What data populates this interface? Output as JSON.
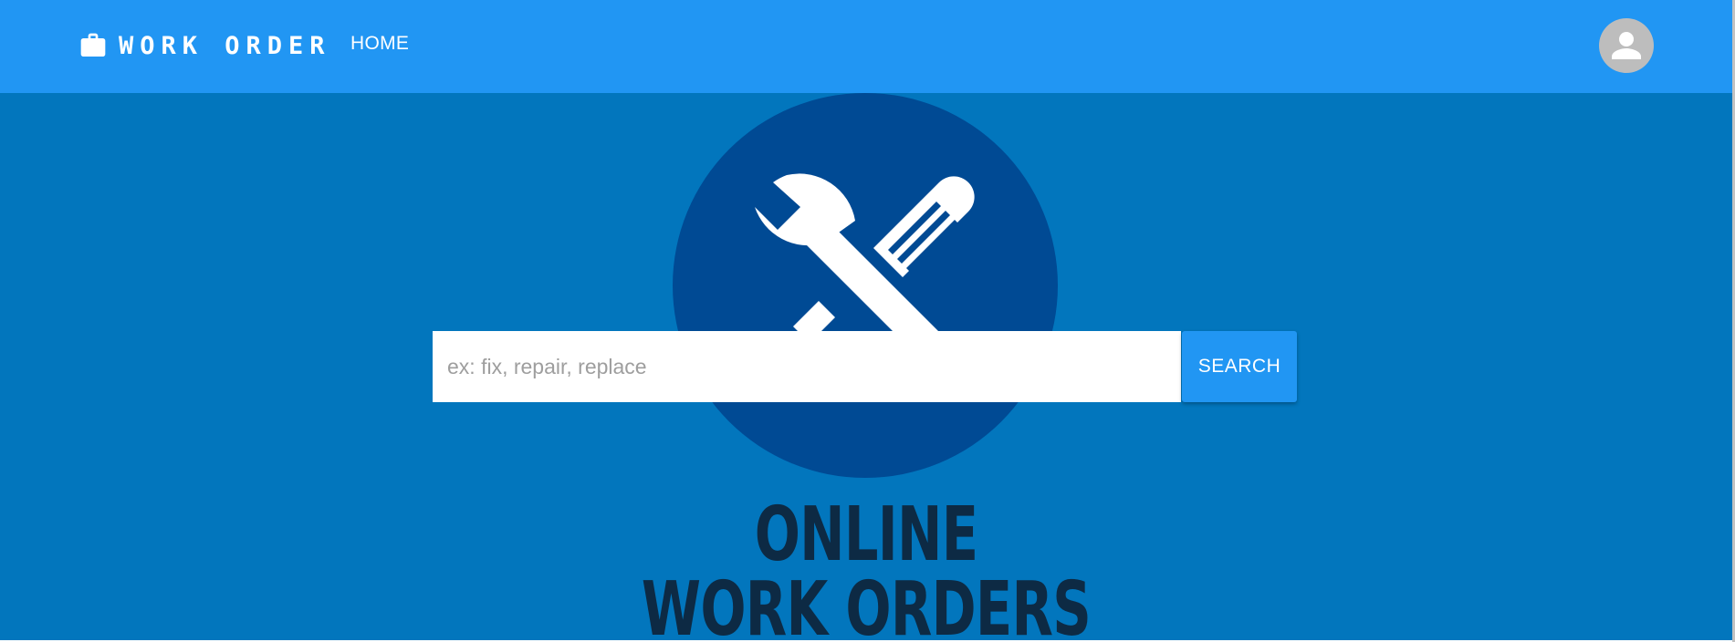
{
  "header": {
    "brand_title": "WORK ORDER",
    "brand_icon": "briefcase-icon",
    "nav": {
      "home_label": "HOME"
    },
    "account_icon": "account-circle-icon"
  },
  "hero": {
    "logo_icon": "wrench-screwdriver-icon",
    "title_line1": "ONLINE",
    "title_line2": "WORK ORDERS"
  },
  "search": {
    "placeholder": "ex: fix, repair, replace",
    "value": "",
    "button_label": "SEARCH"
  },
  "colors": {
    "appbar": "#2196f3",
    "hero_background": "#0276bd",
    "logo_circle": "#004a94",
    "title_text": "#0d2a44",
    "avatar": "#bdbdbd"
  }
}
